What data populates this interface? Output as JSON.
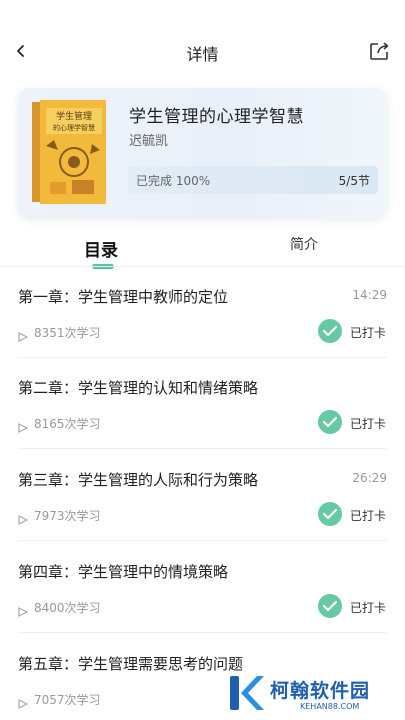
{
  "header": {
    "title": "详情",
    "back_icon": "chevron-left-icon",
    "share_icon": "share-icon"
  },
  "book": {
    "title": "学生管理的心理学智慧",
    "author": "迟毓凯",
    "cover_text": "学生管理的心理学智慧",
    "progress_label": "已完成 100%",
    "progress_fraction": 1.0,
    "sections": "5/5节"
  },
  "tabs": {
    "catalog": "目录",
    "intro": "简介",
    "active": "catalog"
  },
  "chapters": [
    {
      "title": "第一章：学生管理中教师的定位",
      "duration": "14:29",
      "views": "8351次学习",
      "status": "已打卡"
    },
    {
      "title": "第二章：学生管理的认知和情绪策略",
      "duration": "",
      "views": "8165次学习",
      "status": "已打卡"
    },
    {
      "title": "第三章：学生管理的人际和行为策略",
      "duration": "26:29",
      "views": "7973次学习",
      "status": "已打卡"
    },
    {
      "title": "第四章：学生管理中的情境策略",
      "duration": "",
      "views": "8400次学习",
      "status": "已打卡"
    },
    {
      "title": "第五章：学生管理需要思考的问题",
      "duration": "",
      "views": "7057次学习",
      "status": ""
    }
  ],
  "watermark": {
    "name": "柯翰软件园",
    "domain": "KEHAN88.COM"
  },
  "colors": {
    "accent": "#66c9a4",
    "tab_indicator": "#52c4a1",
    "watermark": "#1f5fae"
  }
}
